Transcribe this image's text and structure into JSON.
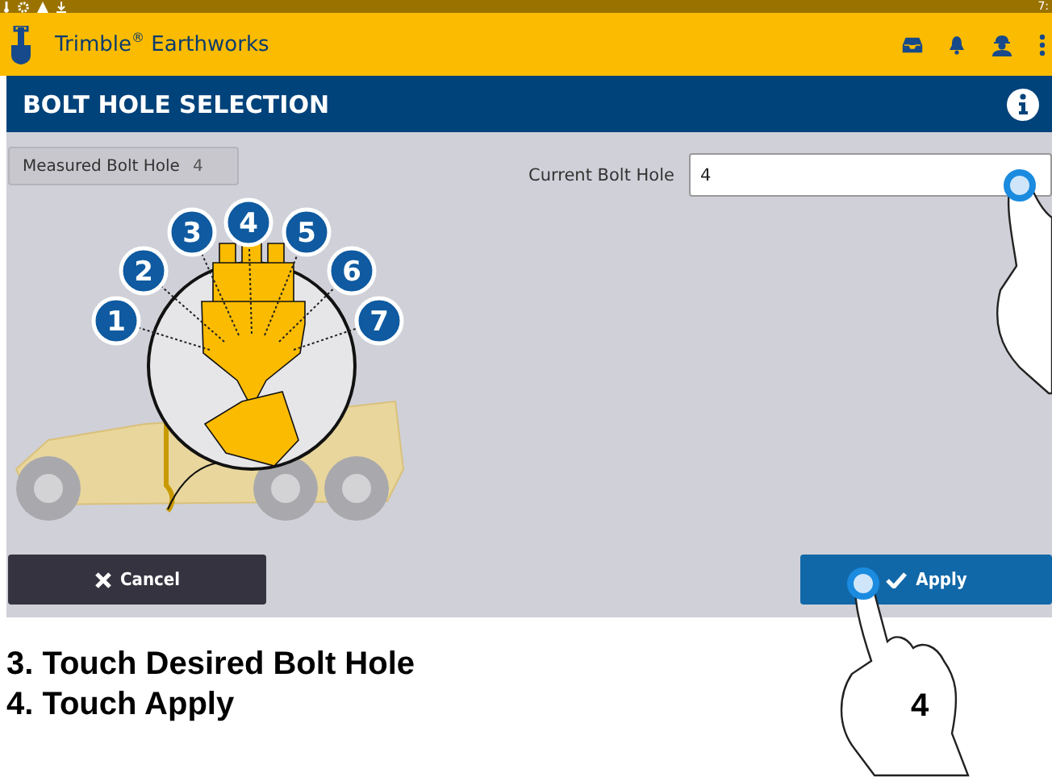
{
  "status_bar": {
    "time": "7:"
  },
  "app_bar": {
    "title": "Trimble$^{®}$ Earthworks"
  },
  "page_title": "BOLT HOLE SELECTION",
  "measured_bolt_hole": {
    "label": "Measured Bolt Hole",
    "value": "4"
  },
  "current_bolt_hole": {
    "label": "Current Bolt Hole",
    "value": "4"
  },
  "bolt_hole_markers": [
    "1",
    "2",
    "3",
    "4",
    "5",
    "6",
    "7"
  ],
  "buttons": [
    {
      "kind": "cancel",
      "label": "Cancel"
    },
    {
      "kind": "apply",
      "label": "Apply"
    }
  ],
  "instructions": [
    "3. Touch Desired Bolt Hole",
    "4. Touch Apply"
  ],
  "step_callout": "4"
}
